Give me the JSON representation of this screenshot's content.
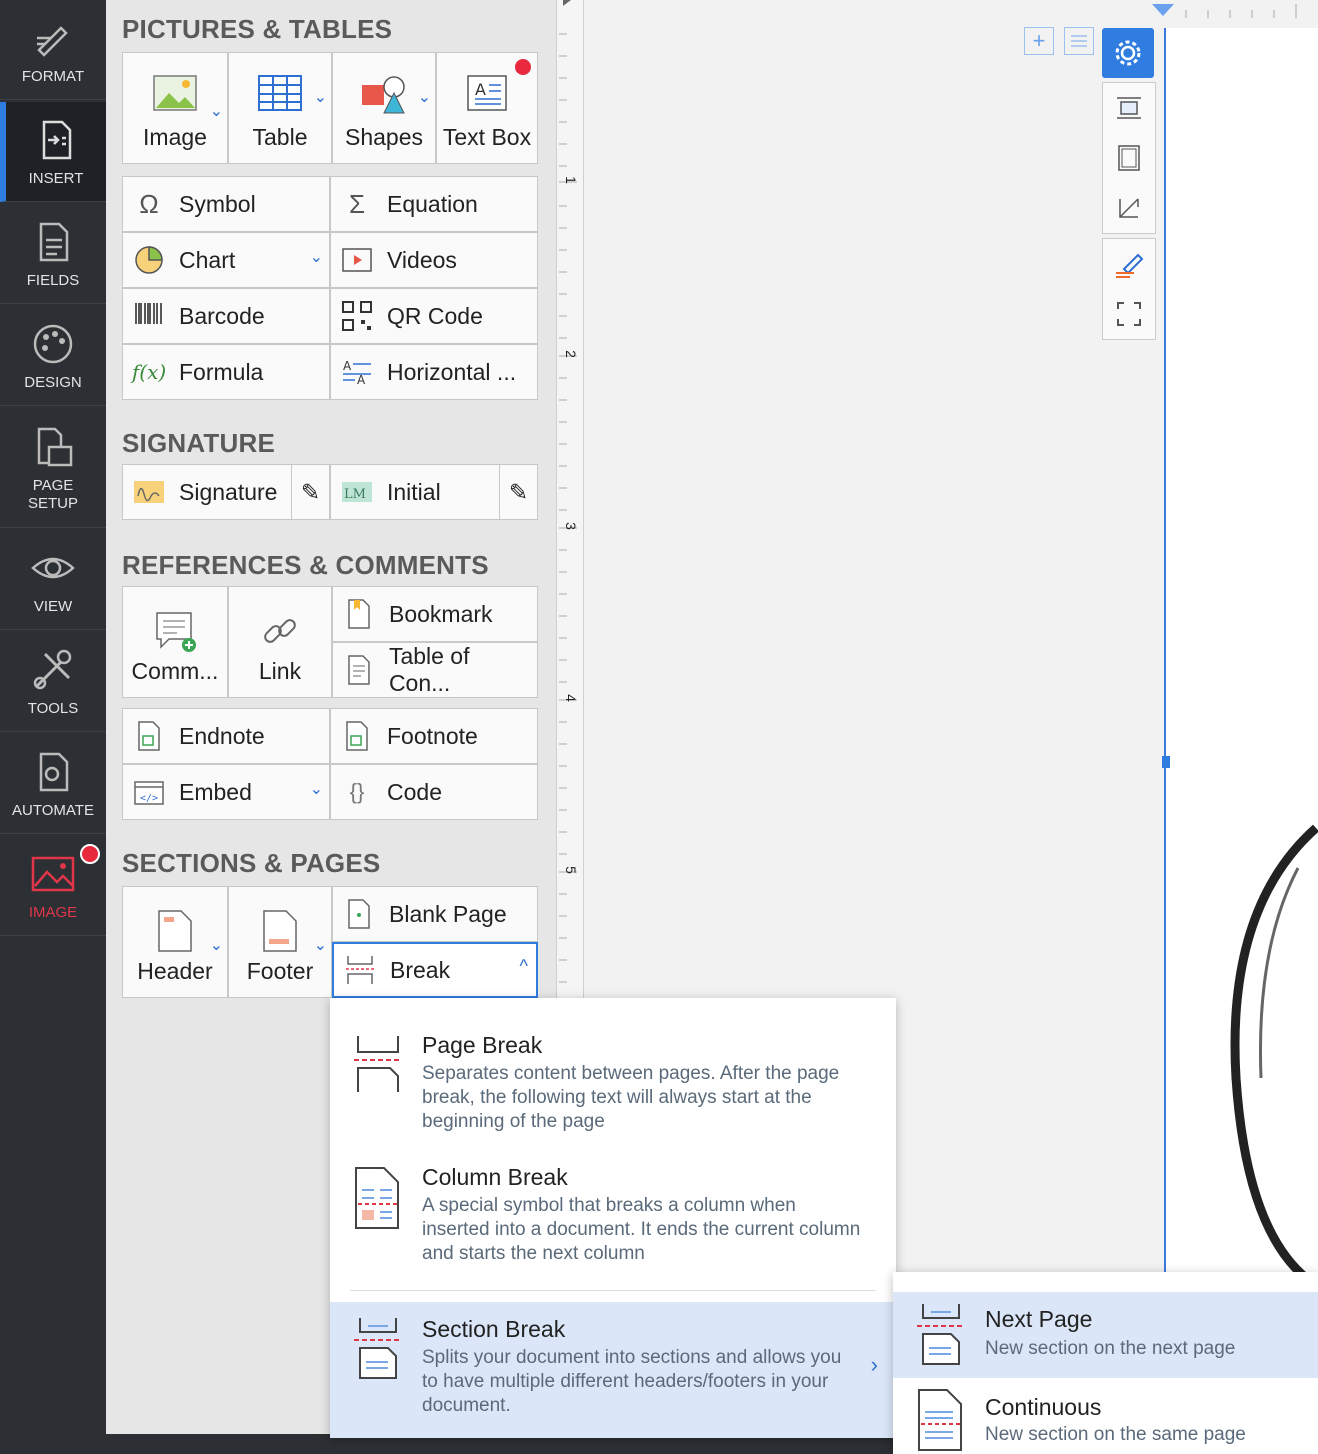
{
  "rail": {
    "items": [
      {
        "label": "FORMAT",
        "icon": "format-pen-icon"
      },
      {
        "label": "INSERT",
        "icon": "insert-doc-icon"
      },
      {
        "label": "FIELDS",
        "icon": "fields-doc-icon"
      },
      {
        "label": "DESIGN",
        "icon": "palette-icon"
      },
      {
        "label": "PAGE SETUP",
        "icon": "page-setup-icon"
      },
      {
        "label": "VIEW",
        "icon": "eye-icon"
      },
      {
        "label": "TOOLS",
        "icon": "tools-icon"
      },
      {
        "label": "AUTOMATE",
        "icon": "automate-gear-icon"
      },
      {
        "label": "IMAGE",
        "icon": "image-icon"
      }
    ]
  },
  "sections": {
    "pictures": "PICTURES & TABLES",
    "signature": "SIGNATURE",
    "references": "REFERENCES & COMMENTS",
    "pages": "SECTIONS & PAGES"
  },
  "pictures": {
    "image": "Image",
    "table": "Table",
    "shapes": "Shapes",
    "textbox": "Text Box",
    "symbol": "Symbol",
    "equation": "Equation",
    "chart": "Chart",
    "videos": "Videos",
    "barcode": "Barcode",
    "qrcode": "QR Code",
    "formula": "Formula",
    "horizontal": "Horizontal ..."
  },
  "signature": {
    "signature": "Signature",
    "initial": "Initial"
  },
  "references": {
    "comment": "Comm...",
    "link": "Link",
    "bookmark": "Bookmark",
    "toc": "Table of Con...",
    "endnote": "Endnote",
    "footnote": "Footnote",
    "embed": "Embed",
    "code": "Code"
  },
  "pages": {
    "header": "Header",
    "footer": "Footer",
    "blank": "Blank Page",
    "break": "Break"
  },
  "ruler": {
    "marks": [
      "1",
      "2",
      "3",
      "4",
      "5"
    ]
  },
  "break_menu": {
    "page_break": {
      "title": "Page Break",
      "desc": "Separates content between pages. After the page break, the following text will always start at the beginning of the page"
    },
    "column_break": {
      "title": "Column Break",
      "desc": "A special symbol that breaks a column when inserted into a document. It ends the current column and starts the next column"
    },
    "section_break": {
      "title": "Section Break",
      "desc": "Splits your document into sections and allows you to have multiple different headers/footers in your document."
    }
  },
  "section_submenu": {
    "next_page": {
      "title": "Next Page",
      "desc": "New section on the next page"
    },
    "continuous": {
      "title": "Continuous",
      "desc": "New section on the same page"
    }
  },
  "colors": {
    "accent": "#2f7de1",
    "highlight": "#dbe7f8",
    "badge": "#e8283c"
  }
}
